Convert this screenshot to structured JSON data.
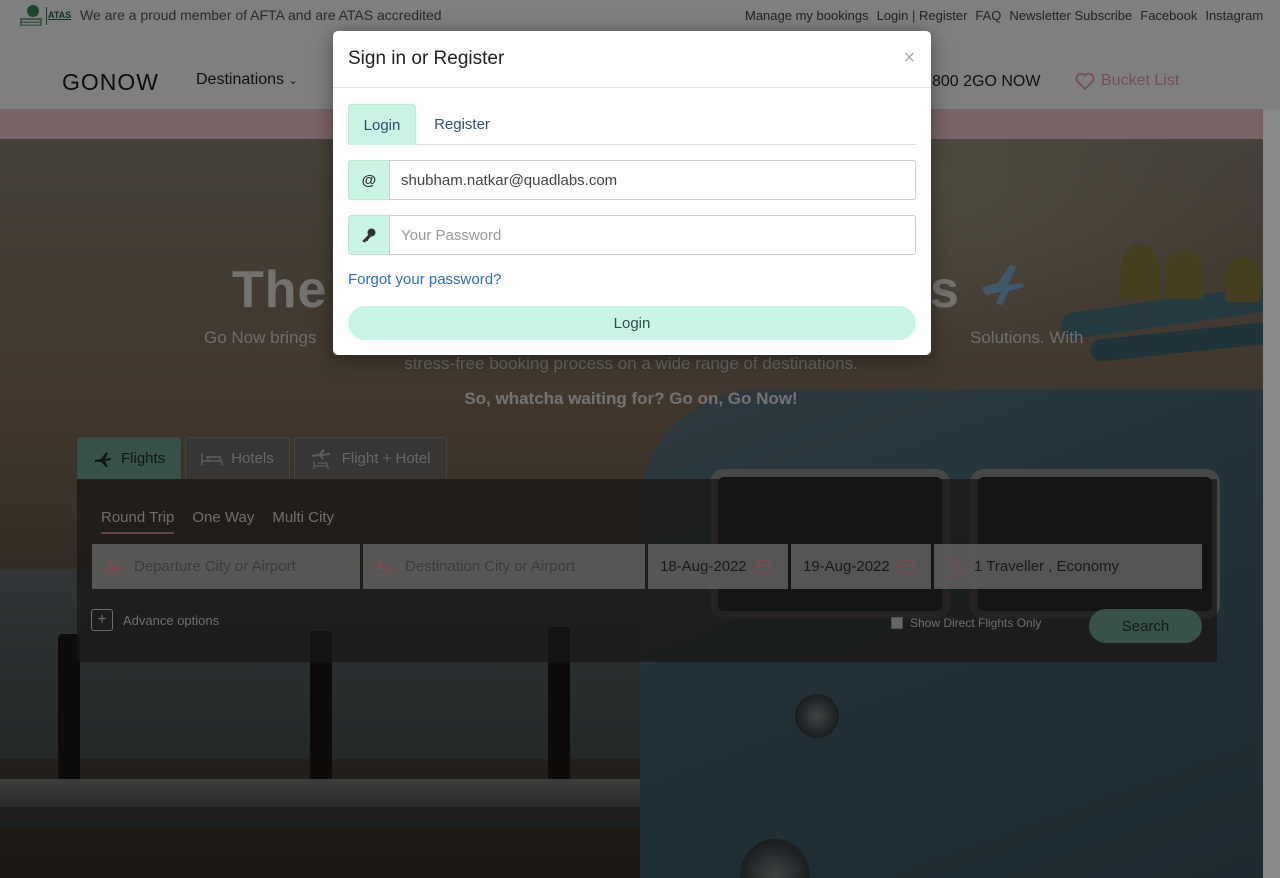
{
  "topbar": {
    "logo_afta": "AFTA",
    "logo_atas": "ATAS",
    "tagline": "We are a proud member of AFTA and are ATAS accredited",
    "links": [
      "Manage my bookings",
      "Login | Register",
      "FAQ",
      "Newsletter Subscribe",
      "Facebook",
      "Instagram"
    ]
  },
  "nav": {
    "brand": "GONOW",
    "destinations": "Destinations",
    "phone": "800 2GO NOW",
    "bucket_list": "Bucket List",
    "accent_color": "#e89aa4"
  },
  "hero": {
    "title_start": "The",
    "title_end": "s",
    "sub1_start": "Go Now brings",
    "sub1_end": "Solutions. With",
    "sub2": "stress-free booking process on a wide range of destinations.",
    "sub3": "So, whatcha waiting for? Go on, Go Now!"
  },
  "search": {
    "product_tabs": [
      "Flights",
      "Hotels",
      "Flight + Hotel"
    ],
    "trip_types": [
      "Round Trip",
      "One Way",
      "Multi City"
    ],
    "departure_placeholder": "Departure City or Airport",
    "destination_placeholder": "Destination City or Airport",
    "depart_date": "18-Aug-2022",
    "return_date": "19-Aug-2022",
    "travellers": "1 Traveller , Economy",
    "advance_options": "Advance options",
    "direct_flights": "Show Direct Flights Only",
    "search_label": "Search",
    "accent_color": "#6fa793"
  },
  "modal": {
    "title": "Sign in or Register",
    "close": "×",
    "tabs": [
      "Login",
      "Register"
    ],
    "email_icon": "@",
    "email_value": "shubham.natkar@quadlabs.com",
    "password_icon": "key-icon",
    "password_placeholder": "Your Password",
    "forgot": "Forgot your password?",
    "login_button": "Login",
    "accent_color": "#c9f5e4"
  }
}
